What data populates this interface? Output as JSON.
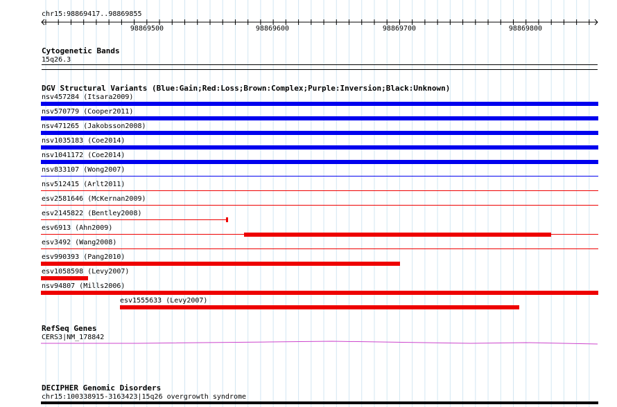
{
  "ruler": {
    "location": "chr15:98869417..98869855",
    "ticks": [
      "98869500",
      "98869600",
      "98869700",
      "98869800"
    ]
  },
  "cytoband": {
    "title": "Cytogenetic Bands",
    "band": "15q26.3"
  },
  "dgv": {
    "title": "DGV Structural Variants (Blue:Gain;Red:Loss;Brown:Complex;Purple:Inversion;Black:Unknown)",
    "colors": {
      "gain": "#0000ee",
      "loss": "#ee0000"
    },
    "variants": [
      {
        "label": "nsv457284 (Itsara2009)",
        "type": "gain"
      },
      {
        "label": "nsv570779 (Cooper2011)",
        "type": "gain"
      },
      {
        "label": "nsv471265 (Jakobsson2008)",
        "type": "gain"
      },
      {
        "label": "nsv1035183 (Coe2014)",
        "type": "gain"
      },
      {
        "label": "nsv1041172 (Coe2014)",
        "type": "gain"
      },
      {
        "label": "nsv833107 (Wong2007)",
        "type": "gain"
      },
      {
        "label": "nsv512415 (Arlt2011)",
        "type": "loss"
      },
      {
        "label": "esv2581646 (McKernan2009)",
        "type": "loss"
      },
      {
        "label": "esv2145822 (Bentley2008)",
        "type": "loss"
      },
      {
        "label": "esv6913 (Ahn2009)",
        "type": "loss"
      },
      {
        "label": "esv3492 (Wang2008)",
        "type": "loss"
      },
      {
        "label": "esv990393 (Pang2010)",
        "type": "loss"
      },
      {
        "label": "esv1058598 (Levy2007)",
        "type": "loss"
      },
      {
        "label": "nsv94807 (Mills2006)",
        "type": "loss"
      },
      {
        "label": "esv1555633 (Levy2007)",
        "type": "loss"
      }
    ]
  },
  "refseq": {
    "title": "RefSeq Genes",
    "gene": "CERS3|NM_178842",
    "color": "#cc44cc"
  },
  "decipher": {
    "title": "DECIPHER Genomic Disorders",
    "entry": "chr15:100338915-3163423|15q26 overgrowth syndrome"
  }
}
